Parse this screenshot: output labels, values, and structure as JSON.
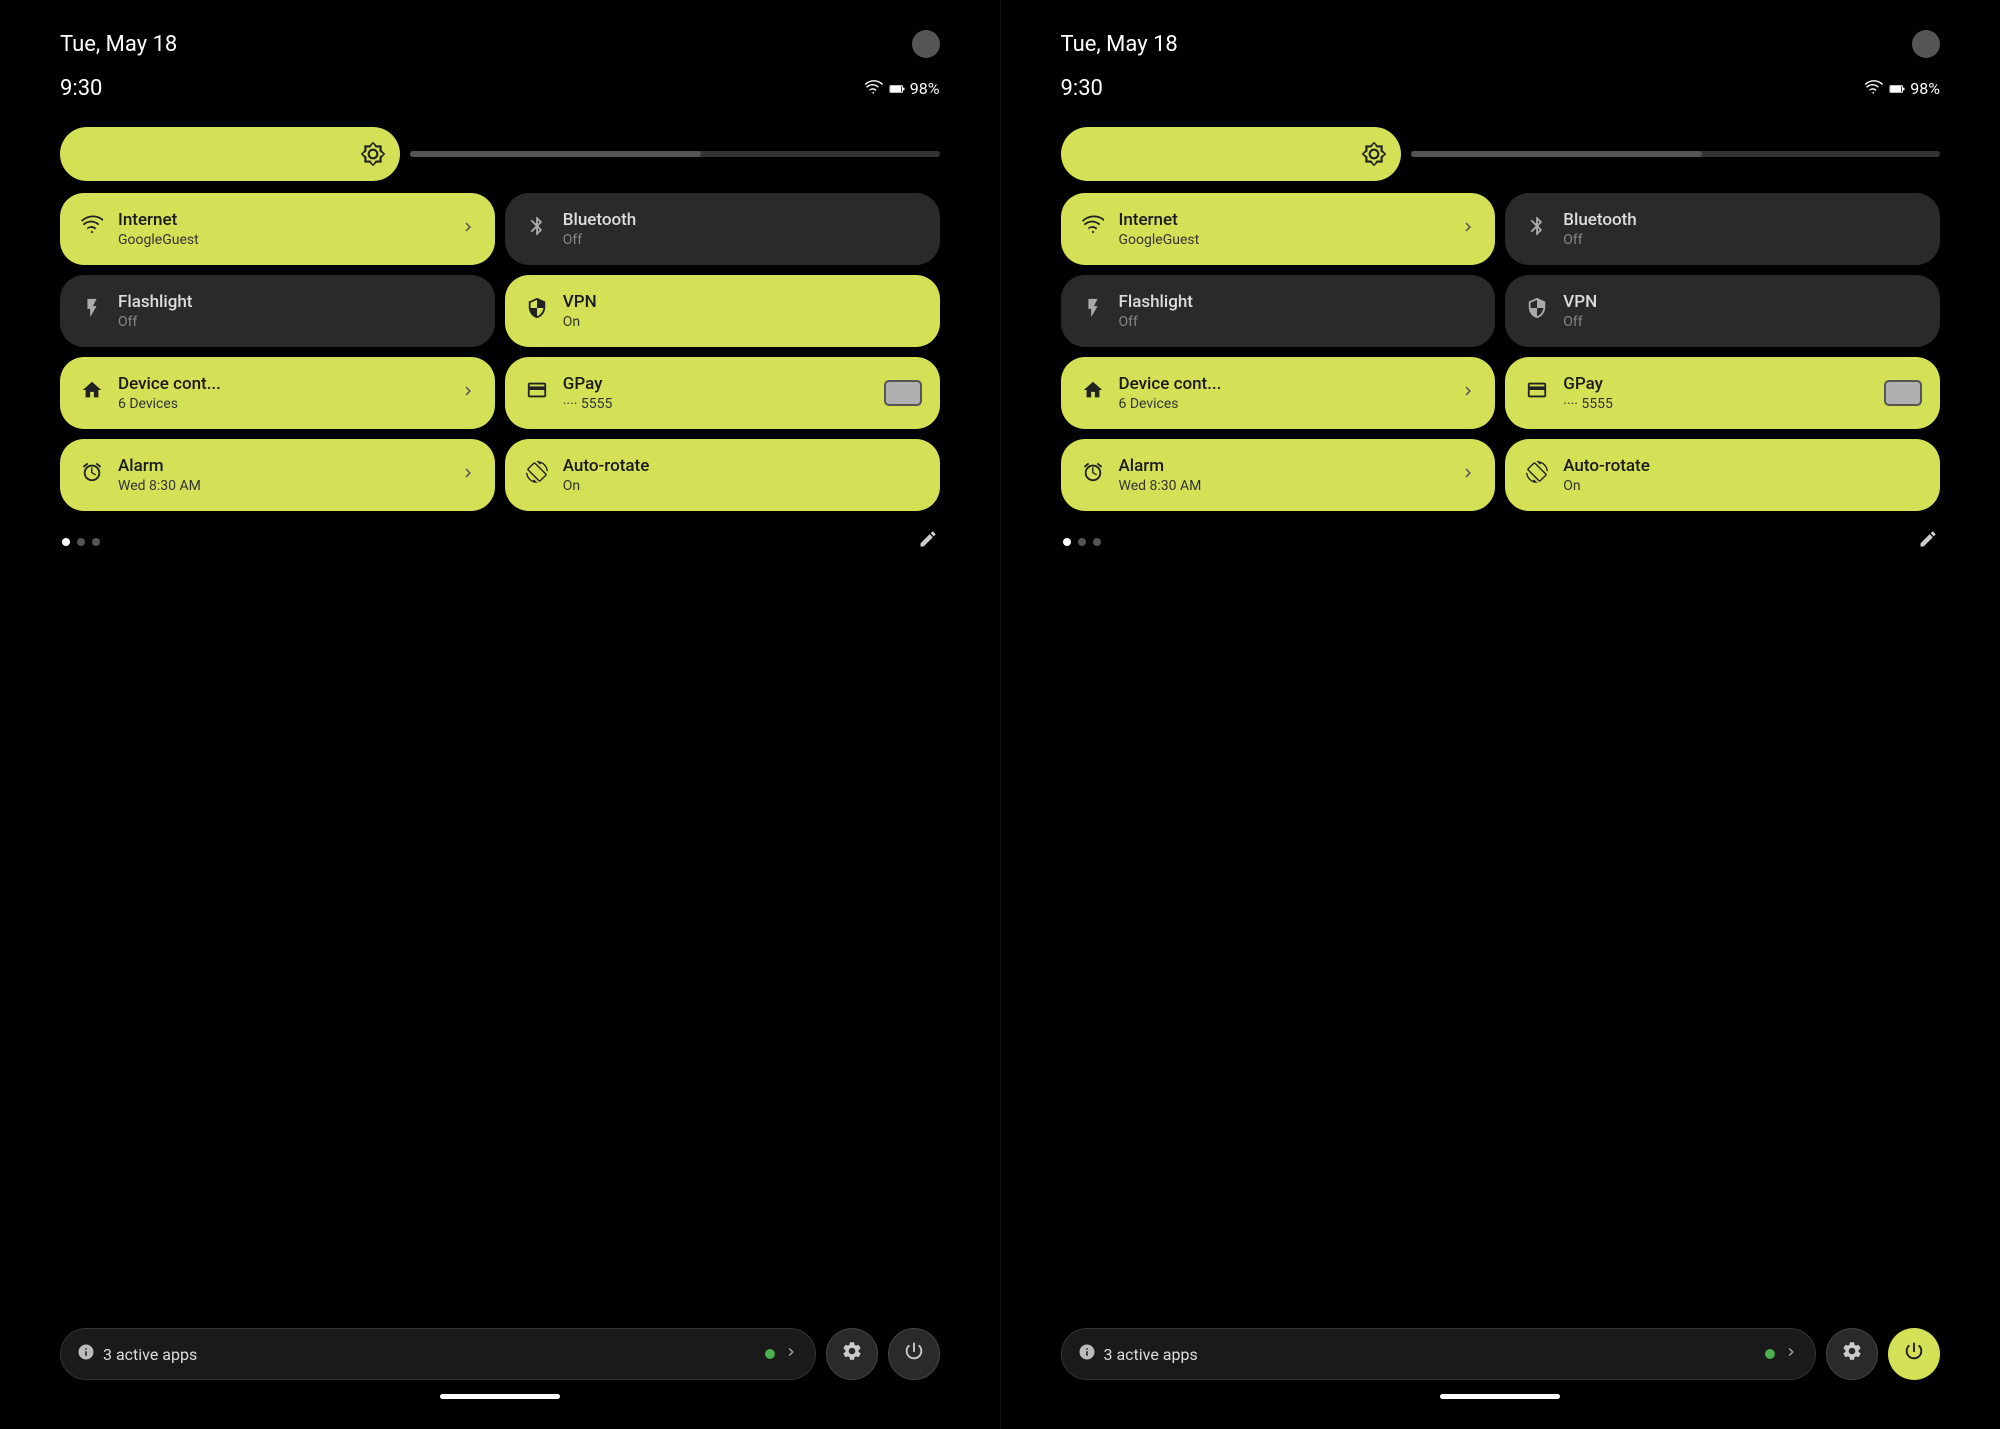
{
  "colors": {
    "active": "#d4e157",
    "inactive": "#2a2a2a",
    "bg": "#000000",
    "text_active": "#1a1a1a",
    "text_inactive": "#dddddd",
    "sub_inactive": "#888888"
  },
  "panels": [
    {
      "id": "left",
      "status_date": "Tue, May 18",
      "status_time": "9:30",
      "battery": "98%",
      "brightness_width": "55%",
      "tiles": [
        {
          "id": "internet",
          "title": "Internet",
          "subtitle": "GoogleGuest",
          "icon": "wifi",
          "state": "active",
          "has_chevron": true
        },
        {
          "id": "bluetooth",
          "title": "Bluetooth",
          "subtitle": "Off",
          "icon": "bluetooth",
          "state": "inactive",
          "has_chevron": false
        },
        {
          "id": "flashlight",
          "title": "Flashlight",
          "subtitle": "Off",
          "icon": "flashlight",
          "state": "inactive",
          "has_chevron": false
        },
        {
          "id": "vpn",
          "title": "VPN",
          "subtitle": "On",
          "icon": "vpn",
          "state": "active",
          "has_chevron": false
        },
        {
          "id": "device",
          "title": "Device cont...",
          "subtitle": "6 Devices",
          "icon": "home",
          "state": "active",
          "has_chevron": true
        },
        {
          "id": "gpay",
          "title": "GPay",
          "subtitle": "···· 5555",
          "icon": "card",
          "state": "active",
          "has_chevron": false
        },
        {
          "id": "alarm",
          "title": "Alarm",
          "subtitle": "Wed 8:30 AM",
          "icon": "alarm",
          "state": "active",
          "has_chevron": true
        },
        {
          "id": "autorotate",
          "title": "Auto-rotate",
          "subtitle": "On",
          "icon": "rotate",
          "state": "active",
          "has_chevron": false
        }
      ],
      "active_apps_label": "3 active apps",
      "power_btn_variant": "dark"
    },
    {
      "id": "right",
      "status_date": "Tue, May 18",
      "status_time": "9:30",
      "battery": "98%",
      "brightness_width": "55%",
      "tiles": [
        {
          "id": "internet",
          "title": "Internet",
          "subtitle": "GoogleGuest",
          "icon": "wifi",
          "state": "active",
          "has_chevron": true
        },
        {
          "id": "bluetooth",
          "title": "Bluetooth",
          "subtitle": "Off",
          "icon": "bluetooth",
          "state": "inactive",
          "has_chevron": false
        },
        {
          "id": "flashlight",
          "title": "Flashlight",
          "subtitle": "Off",
          "icon": "flashlight",
          "state": "inactive",
          "has_chevron": false
        },
        {
          "id": "vpn",
          "title": "VPN",
          "subtitle": "Off",
          "icon": "vpn",
          "state": "inactive",
          "has_chevron": false
        },
        {
          "id": "device",
          "title": "Device cont...",
          "subtitle": "6 Devices",
          "icon": "home",
          "state": "active",
          "has_chevron": true
        },
        {
          "id": "gpay",
          "title": "GPay",
          "subtitle": "···· 5555",
          "icon": "card",
          "state": "active",
          "has_chevron": false
        },
        {
          "id": "alarm",
          "title": "Alarm",
          "subtitle": "Wed 8:30 AM",
          "icon": "alarm",
          "state": "active",
          "has_chevron": true
        },
        {
          "id": "autorotate",
          "title": "Auto-rotate",
          "subtitle": "On",
          "icon": "rotate",
          "state": "active",
          "has_chevron": false
        }
      ],
      "active_apps_label": "3 active apps",
      "power_btn_variant": "light"
    }
  ],
  "dots": [
    {
      "active": true
    },
    {
      "active": false
    },
    {
      "active": false
    }
  ]
}
